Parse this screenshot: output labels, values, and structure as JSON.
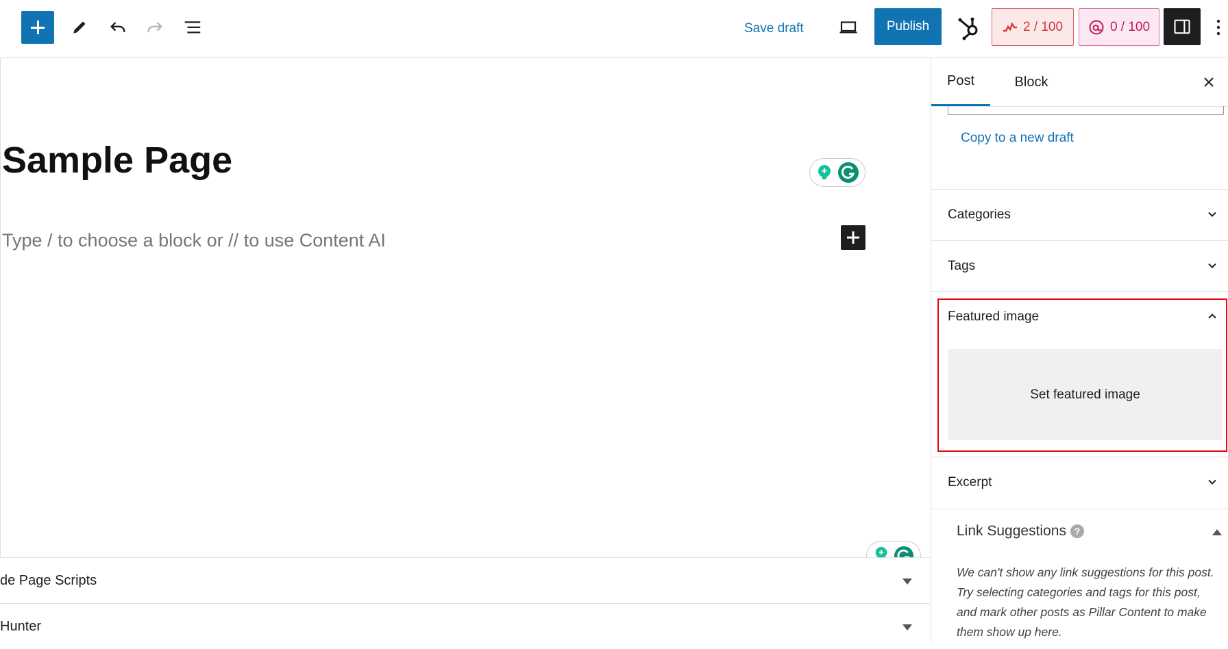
{
  "toolbar": {
    "save_draft": "Save draft",
    "publish": "Publish",
    "seo_score": "2 / 100",
    "ai_score": "0 / 100",
    "icons": [
      "plus-icon",
      "pencil-icon",
      "undo-icon",
      "redo-icon",
      "list-view-icon",
      "desktop-preview-icon",
      "hubspot-icon",
      "seo-score-icon",
      "content-ai-icon",
      "sidebar-toggle-icon",
      "more-options-icon"
    ],
    "colors": {
      "primary": "#1273b3",
      "seo": "#d63638",
      "ai": "#c2185b"
    }
  },
  "editor": {
    "title": "Sample Page",
    "placeholder": "Type / to choose a block or // to use Content AI"
  },
  "meta_boxes": [
    {
      "label": "de Page Scripts"
    },
    {
      "label": "Hunter"
    }
  ],
  "sidebar": {
    "tabs": [
      "Post",
      "Block"
    ],
    "active_tab": "Post",
    "copy_link": "Copy to a new draft",
    "panels": {
      "categories": "Categories",
      "tags": "Tags",
      "featured_image": "Featured image",
      "set_featured": "Set featured image",
      "excerpt": "Excerpt"
    },
    "link_suggestions": {
      "title": "Link Suggestions",
      "help": "?",
      "text": "We can't show any link suggestions for this post. Try selecting categories and tags for this post, and mark other posts as Pillar Content to make them show up here."
    },
    "highlight_color": "#e30613"
  }
}
